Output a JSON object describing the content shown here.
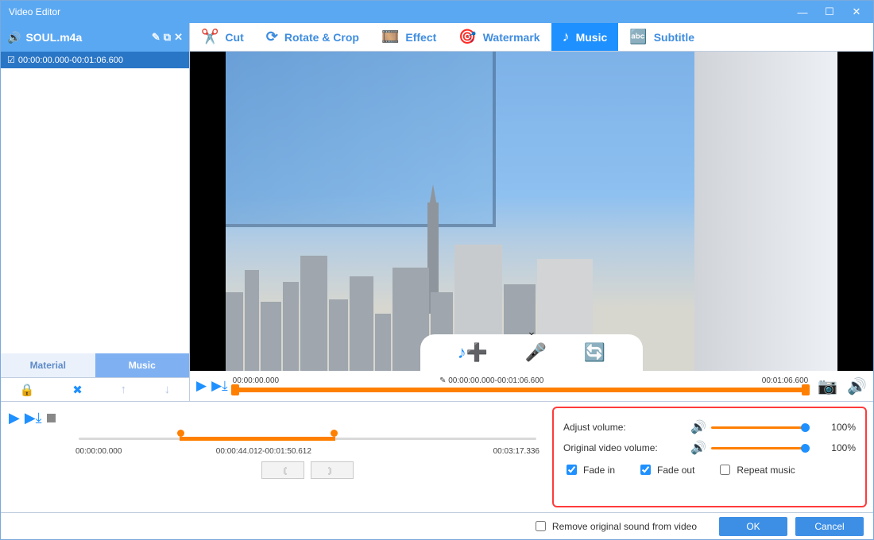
{
  "window": {
    "title": "Video Editor"
  },
  "sidebar": {
    "file_name": "SOUL.m4a",
    "track_range": "00:00:00.000-00:01:06.600",
    "tabs": {
      "material": "Material",
      "music": "Music"
    }
  },
  "toolbar": {
    "cut": "Cut",
    "rotate": "Rotate & Crop",
    "effect": "Effect",
    "watermark": "Watermark",
    "music": "Music",
    "subtitle": "Subtitle"
  },
  "preview_timeline": {
    "start": "00:00:00.000",
    "segment": "00:00:00.000-00:01:06.600",
    "end": "00:01:06.600"
  },
  "bottom_timeline": {
    "start": "00:00:00.000",
    "sel_range": "00:00:44.012-00:01:50.612",
    "end": "00:03:17.336"
  },
  "volume": {
    "adjust_label": "Adjust volume:",
    "adjust_pct": "100%",
    "orig_label": "Original video volume:",
    "orig_pct": "100%",
    "fade_in": "Fade in",
    "fade_out": "Fade out",
    "repeat": "Repeat music"
  },
  "footer": {
    "remove_sound": "Remove original sound from video",
    "ok": "OK",
    "cancel": "Cancel"
  }
}
